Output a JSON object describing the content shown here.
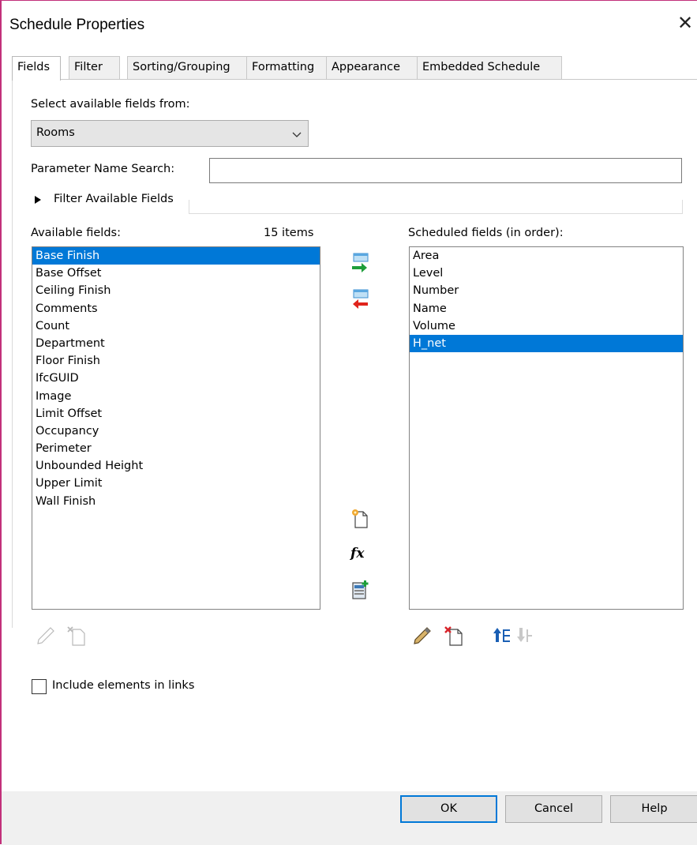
{
  "window": {
    "title": "Schedule Properties",
    "close_glyph": "✕"
  },
  "tabs": [
    {
      "label": "Fields",
      "active": true
    },
    {
      "label": "Filter"
    },
    {
      "label": "Sorting/Grouping"
    },
    {
      "label": "Formatting"
    },
    {
      "label": "Appearance"
    },
    {
      "label": "Embedded Schedule"
    }
  ],
  "fields_tab": {
    "select_from_label": "Select available fields from:",
    "select_from_value": "Rooms",
    "param_search_label": "Parameter Name Search:",
    "param_search_value": "",
    "filter_available_label": "Filter Available Fields",
    "available_label": "Available fields:",
    "available_count": "15 items",
    "available_fields": [
      "Base Finish",
      "Base Offset",
      "Ceiling Finish",
      "Comments",
      "Count",
      "Department",
      "Floor Finish",
      "IfcGUID",
      "Image",
      "Limit Offset",
      "Occupancy",
      "Perimeter",
      "Unbounded Height",
      "Upper Limit",
      "Wall Finish"
    ],
    "available_selected": "Base Finish",
    "scheduled_label": "Scheduled fields (in order):",
    "scheduled_fields": [
      "Area",
      "Level",
      "Number",
      "Name",
      "Volume",
      "H_net"
    ],
    "scheduled_selected": "H_net",
    "include_links_label": "Include elements in links",
    "include_links_checked": false
  },
  "icons": {
    "add_field": "add-parameter-icon",
    "remove_field": "remove-parameter-icon",
    "new_parameter": "new-parameter-icon",
    "calculated_value": "calculated-value-icon",
    "combine_parameters": "combine-parameters-icon",
    "edit_left": "edit-pencil-icon",
    "delete_left": "delete-parameter-icon",
    "edit_right": "edit-pencil-icon",
    "delete_right": "delete-parameter-icon",
    "move_up": "move-up-icon",
    "move_down": "move-down-icon",
    "fx_glyph": "fx"
  },
  "buttons": {
    "ok": "OK",
    "cancel": "Cancel",
    "help": "Help"
  },
  "colors": {
    "selection": "#0078d7",
    "accent_border": "#c2307a",
    "add_arrow": "#1e9e3a",
    "remove_arrow": "#e0241c"
  }
}
